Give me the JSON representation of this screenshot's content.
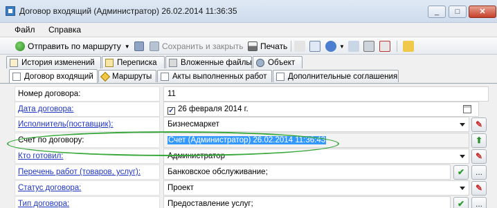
{
  "window": {
    "title": "Договор входящий (Администратор) 26.02.2014 11:36:35",
    "minimize": "_",
    "maximize": "□",
    "close": "✕"
  },
  "menu": {
    "file": "Файл",
    "help": "Справка"
  },
  "toolbar": {
    "send_route": "Отправить по маршруту",
    "save_close": "Сохранить и закрыть",
    "print": "Печать"
  },
  "tabs_row1": [
    {
      "label": "История изменений",
      "icon": "history-icon"
    },
    {
      "label": "Переписка",
      "icon": "envelope-icon"
    },
    {
      "label": "Вложенные файлы",
      "icon": "paperclip-icon"
    },
    {
      "label": "Объект",
      "icon": "gear-icon"
    }
  ],
  "tabs_row2": [
    {
      "label": "Договор входящий",
      "icon": "document-icon",
      "active": true
    },
    {
      "label": "Маршруты",
      "icon": "route-icon"
    },
    {
      "label": "Акты выполненных работ",
      "icon": "document-icon"
    },
    {
      "label": "Дополнительные соглашения",
      "icon": "document-icon"
    }
  ],
  "form": {
    "contract_number": {
      "label": "Номер договора:",
      "value": "11"
    },
    "contract_date": {
      "label": "Дата договора:",
      "day": "26",
      "month_year": "февраля  2014 г.",
      "checked": true
    },
    "contractor": {
      "label": "Исполнитель(поставщик):",
      "value": "Бизнесмаркет"
    },
    "invoice": {
      "label": "Счет по договору:",
      "value": "Счет (Администратор) 26.02.2014 11:36:43"
    },
    "prepared_by": {
      "label": "Кто готовил:",
      "value": "Администратор"
    },
    "works_list": {
      "label": "Перечень работ (товаров, услуг):",
      "value": "Банковское обслуживание;"
    },
    "status": {
      "label": "Статус договора:",
      "value": "Проект"
    },
    "contract_type": {
      "label": "Тип договора:",
      "value": "Предоставление услуг;"
    }
  },
  "buttons": {
    "edit": "✎",
    "go": "⬆",
    "confirm": "✔",
    "browse": "..."
  },
  "colors": {
    "link": "#1f35c4",
    "highlight": "#38a83a",
    "selection": "#3399ff"
  }
}
